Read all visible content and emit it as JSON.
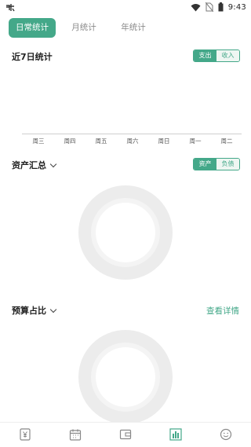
{
  "status_bar": {
    "time": "9:43",
    "icons": [
      "app-notification-icon",
      "wifi-icon",
      "no-sim-icon",
      "battery-icon"
    ]
  },
  "tabs": [
    {
      "label": "日常统计",
      "active": true
    },
    {
      "label": "月统计",
      "active": false
    },
    {
      "label": "年统计",
      "active": false
    }
  ],
  "weekly": {
    "title": "近7日统计",
    "toggle": {
      "left": "支出",
      "right": "收入",
      "selected": "支出"
    },
    "days": [
      "周三",
      "周四",
      "周五",
      "周六",
      "周日",
      "周一",
      "周二"
    ]
  },
  "assets": {
    "title": "资产汇总",
    "toggle": {
      "left": "资产",
      "right": "负债",
      "selected": "资产"
    }
  },
  "budget": {
    "title": "预算占比",
    "details_link": "查看详情"
  },
  "bottom_nav": [
    {
      "name": "yuan-icon"
    },
    {
      "name": "calendar-icon"
    },
    {
      "name": "wallet-icon"
    },
    {
      "name": "chart-icon",
      "active": true
    },
    {
      "name": "smiley-icon"
    }
  ],
  "colors": {
    "accent": "#44a889",
    "ring_outer": "#ececec",
    "ring_inner": "#f3f3f3",
    "inactive": "#8a8a8a"
  }
}
